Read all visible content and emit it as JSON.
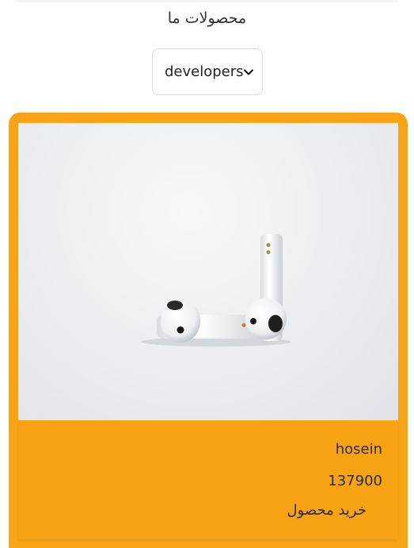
{
  "header": {
    "title": "محصولات ما"
  },
  "filter": {
    "selected": "developers",
    "chevron_icon": "chevron-down-icon"
  },
  "product": {
    "image_subject": "earbuds-photo",
    "name": "hosein",
    "price": "137900",
    "buy_label": "خرید محصول"
  },
  "colors": {
    "card_background": "#f8a414",
    "page_background": "#ffffff"
  }
}
